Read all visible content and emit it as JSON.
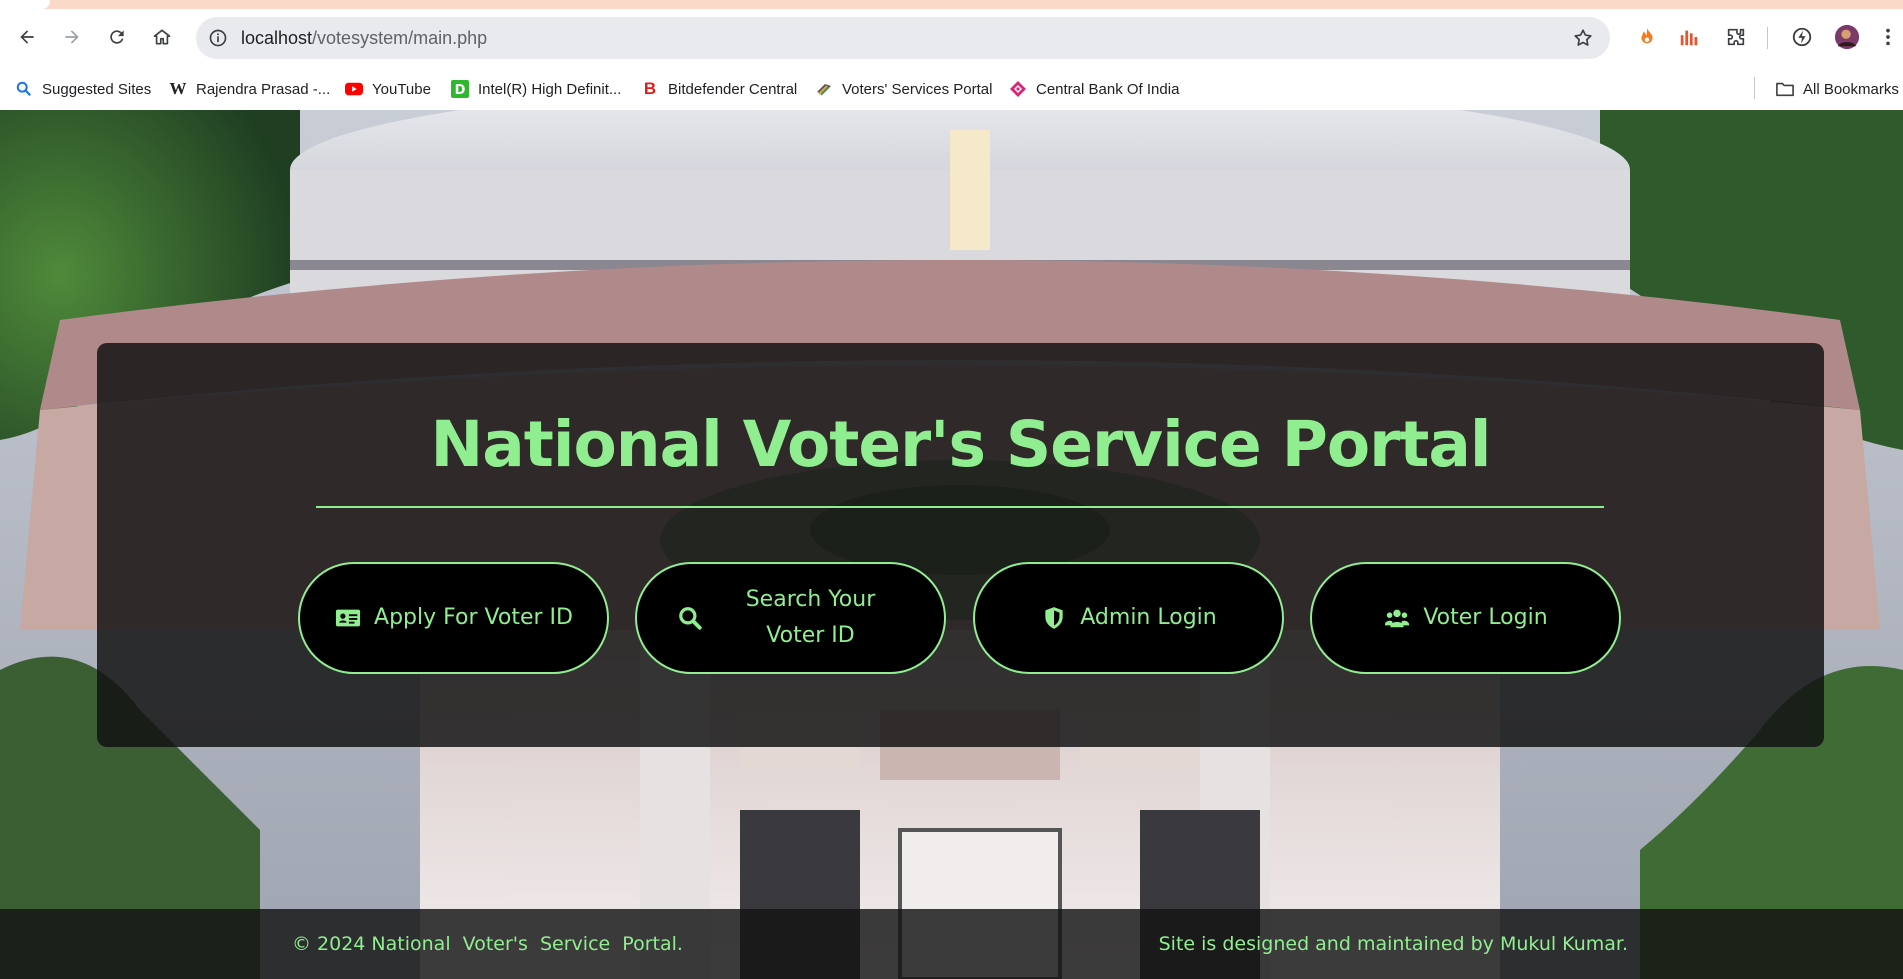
{
  "browser": {
    "url_host": "localhost",
    "url_path": "/votesystem/main.php",
    "bookmarks": [
      {
        "label": "Suggested Sites",
        "icon": "magnifier-icon"
      },
      {
        "label": "Rajendra Prasad -...",
        "icon": "wikipedia-icon"
      },
      {
        "label": "YouTube",
        "icon": "youtube-icon"
      },
      {
        "label": "Intel(R) High Definit...",
        "icon": "d-icon"
      },
      {
        "label": "Bitdefender Central",
        "icon": "bitdefender-icon"
      },
      {
        "label": "Voters' Services Portal",
        "icon": "evm-icon"
      },
      {
        "label": "Central Bank Of India",
        "icon": "bank-icon"
      }
    ],
    "all_bookmarks_label": "All Bookmarks"
  },
  "page": {
    "title": "National Voter's Service Portal",
    "accent_color": "#90ee90",
    "buttons": [
      {
        "label": "Apply For Voter ID",
        "icon": "id-card-icon"
      },
      {
        "label": "Search Your Voter ID",
        "icon": "search-icon"
      },
      {
        "label": "Admin Login",
        "icon": "shield-icon"
      },
      {
        "label": "Voter Login",
        "icon": "users-icon"
      }
    ],
    "footer": {
      "left": "© 2024 National  Voter's  Service  Portal.",
      "right": "Site is designed and maintained by Mukul Kumar."
    }
  }
}
